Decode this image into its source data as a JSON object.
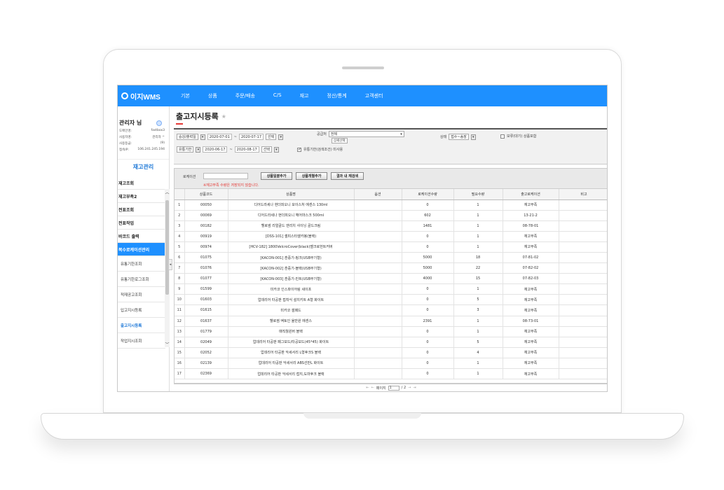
{
  "app": {
    "logo": "이지WMS",
    "menu": [
      "기본",
      "상품",
      "주문/배송",
      "C/S",
      "재고",
      "정산/통계",
      "고객센터"
    ]
  },
  "sidebar": {
    "user_name": "관리자 님",
    "info": [
      {
        "label": "도메인명:",
        "value": "fastbox3"
      },
      {
        "label": "사용자명:",
        "value": "관리자 ^"
      },
      {
        "label": "사용등급:",
        "value": "(9)"
      },
      {
        "label": "접속IP:",
        "value": "106.241.245.194"
      }
    ],
    "section_title": "재고관리",
    "items": [
      "재고조회",
      "재고부족2",
      "전표조회",
      "전표작업",
      "바코드 출력",
      "복수로케이션관리"
    ],
    "sub_items": [
      "유통기한조회",
      "유통기한로그조회",
      "적재공고조회",
      "입고지시등록",
      "출고지시등록",
      "작업지시조회"
    ],
    "current_sub": "출고지시등록"
  },
  "page": {
    "title": "출고지시등록"
  },
  "filters": {
    "date_type": "승강/출력일",
    "date_from": "2020-07-01",
    "date_to": "2020-07-17",
    "date_select": "선택",
    "supplier_label": "공급처",
    "supplier_value": "전체",
    "detail_btn": "상세선택",
    "status_label": "상태",
    "status_value": "접수~송장",
    "hold_label": "보류(대기) 상품포함",
    "expiry_type": "유통기한",
    "expiry_from": "2020-06-17",
    "expiry_to": "2020-08-17",
    "expiry_select": "선택",
    "expiry_unused_label": "유통기한(검색조건) 미사용"
  },
  "actions": {
    "location_label": "로케이션",
    "btn_bulk": "상품일괄추가",
    "btn_single": "상품개별추가",
    "btn_research": "결과 내 재검색",
    "warning": "※재고부족 수량은 저장되지 않습니다."
  },
  "table": {
    "columns": [
      "",
      "상품코드",
      "상품명",
      "옵션",
      "로케이션수량",
      "필요수량",
      "출고로케이션",
      "비고"
    ],
    "rows": [
      [
        "1",
        "00050",
        "디어드라세나 현더피오니 모이스처 에센스 130ml",
        "",
        "0",
        "1",
        "재고부족",
        ""
      ],
      [
        "2",
        "00069",
        "디어드라세나 현더피오니 헤어마스크 500ml",
        "",
        "602",
        "1",
        "13-21-2",
        ""
      ],
      [
        "3",
        "00182",
        "헬로썸 리얼골드 앤리치 샤이닝 골드크림",
        "",
        "1481",
        "1",
        "08-78-01",
        ""
      ],
      [
        "4",
        "00919",
        "[DSS-101] 셀피스타셀카봉(블랙)",
        "",
        "0",
        "1",
        "재고부족",
        ""
      ],
      [
        "5",
        "00974",
        "[HCV-182] 1800VelcroCover(black)벨크로헌트커버",
        "",
        "0",
        "1",
        "재고부족",
        ""
      ],
      [
        "6",
        "01075",
        "[KACON-001] 훈증기-핑크(USB무기형)",
        "",
        "5000",
        "18",
        "07-81-02",
        ""
      ],
      [
        "7",
        "01076",
        "[KACON-002] 훈증기-블랙(USB무기형)",
        "",
        "5000",
        "22",
        "07-82-02",
        ""
      ],
      [
        "8",
        "01077",
        "[KACON-003] 훈증기-민트(USB무기형)",
        "",
        "4000",
        "15",
        "07-82-03",
        ""
      ],
      [
        "9",
        "01599",
        "미카코 인스파이어링 세이프",
        "",
        "0",
        "1",
        "재고부족",
        ""
      ],
      [
        "10",
        "01603",
        "업데리어 타공판 접착식 설치키트 A형 화이트",
        "",
        "0",
        "5",
        "재고부족",
        ""
      ],
      [
        "11",
        "01615",
        "미카코 갤패드",
        "",
        "0",
        "3",
        "재고부족",
        ""
      ],
      [
        "12",
        "01637",
        "헬로썸 액토인 율만원 에센스",
        "",
        "2391",
        "1",
        "08-73-01",
        ""
      ],
      [
        "13",
        "01779",
        "매직월원버 블랙",
        "",
        "0",
        "1",
        "재고부족",
        ""
      ],
      [
        "14",
        "02049",
        "업데리어 타공판 페그보드/타공보드(45*45) 화이트",
        "",
        "0",
        "5",
        "재고부족",
        ""
      ],
      [
        "15",
        "02052",
        "업데리어 타공판 악세서리 L형후크S 블랙",
        "",
        "0",
        "4",
        "재고부족",
        ""
      ],
      [
        "16",
        "02139",
        "업데리어 타공판 악세서리 ABS선반L 화이트",
        "",
        "0",
        "1",
        "재고부족",
        ""
      ],
      [
        "17",
        "02369",
        "업데리어 타공판 악세서리 접지,도마후크 블랙",
        "",
        "0",
        "1",
        "재고부족",
        ""
      ]
    ]
  },
  "pager": {
    "prefix": "페이지",
    "current": "1",
    "total": "/ 2"
  },
  "colors": {
    "brand": "#1e90ff",
    "accent_red": "#e53935"
  }
}
